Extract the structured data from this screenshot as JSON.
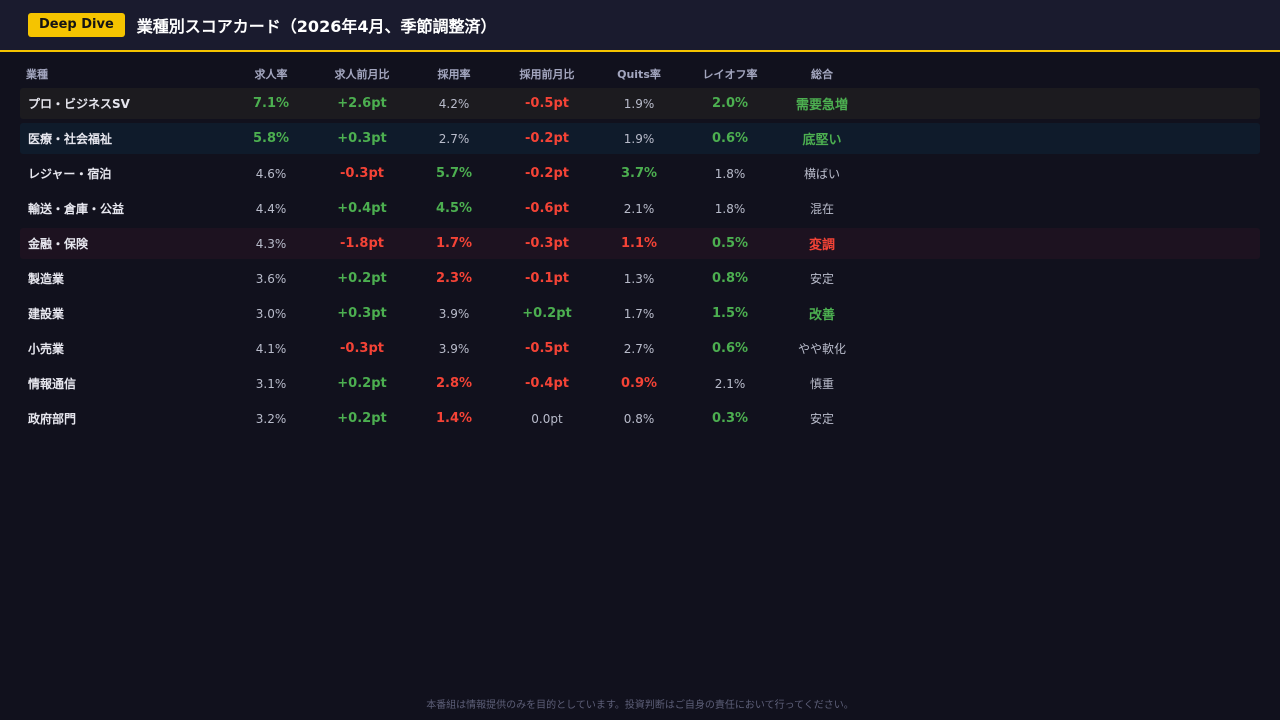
{
  "header": {
    "badge": "Deep Dive",
    "title": "業種別スコアカード（2026年4月、季節調整済）"
  },
  "table": {
    "columns": [
      "業種",
      "求人率",
      "求人前月比",
      "採用率",
      "採用前月比",
      "Quits率",
      "レイオフ率",
      "総合"
    ],
    "rows": [
      {
        "highlight": "amber",
        "cells": [
          {
            "text": "プロ・ビジネスSV",
            "tone": "name"
          },
          {
            "text": "7.1%",
            "tone": "green"
          },
          {
            "text": "+2.6pt",
            "tone": "green"
          },
          {
            "text": "4.2%",
            "tone": "plain"
          },
          {
            "text": "-0.5pt",
            "tone": "red"
          },
          {
            "text": "1.9%",
            "tone": "plain"
          },
          {
            "text": "2.0%",
            "tone": "green"
          },
          {
            "text": "需要急増",
            "tone": "green"
          }
        ]
      },
      {
        "highlight": "blue",
        "cells": [
          {
            "text": "医療・社会福祉",
            "tone": "name"
          },
          {
            "text": "5.8%",
            "tone": "green"
          },
          {
            "text": "+0.3pt",
            "tone": "green"
          },
          {
            "text": "2.7%",
            "tone": "plain"
          },
          {
            "text": "-0.2pt",
            "tone": "red"
          },
          {
            "text": "1.9%",
            "tone": "plain"
          },
          {
            "text": "0.6%",
            "tone": "green"
          },
          {
            "text": "底堅い",
            "tone": "green"
          }
        ]
      },
      {
        "highlight": "none",
        "cells": [
          {
            "text": "レジャー・宿泊",
            "tone": "name"
          },
          {
            "text": "4.6%",
            "tone": "plain"
          },
          {
            "text": "-0.3pt",
            "tone": "red"
          },
          {
            "text": "5.7%",
            "tone": "green"
          },
          {
            "text": "-0.2pt",
            "tone": "red"
          },
          {
            "text": "3.7%",
            "tone": "green"
          },
          {
            "text": "1.8%",
            "tone": "plain"
          },
          {
            "text": "横ばい",
            "tone": "plain"
          }
        ]
      },
      {
        "highlight": "none",
        "cells": [
          {
            "text": "輸送・倉庫・公益",
            "tone": "name"
          },
          {
            "text": "4.4%",
            "tone": "plain"
          },
          {
            "text": "+0.4pt",
            "tone": "green"
          },
          {
            "text": "4.5%",
            "tone": "green"
          },
          {
            "text": "-0.6pt",
            "tone": "red"
          },
          {
            "text": "2.1%",
            "tone": "plain"
          },
          {
            "text": "1.8%",
            "tone": "plain"
          },
          {
            "text": "混在",
            "tone": "plain"
          }
        ]
      },
      {
        "highlight": "red",
        "cells": [
          {
            "text": "金融・保険",
            "tone": "name"
          },
          {
            "text": "4.3%",
            "tone": "plain"
          },
          {
            "text": "-1.8pt",
            "tone": "red"
          },
          {
            "text": "1.7%",
            "tone": "red"
          },
          {
            "text": "-0.3pt",
            "tone": "red"
          },
          {
            "text": "1.1%",
            "tone": "red"
          },
          {
            "text": "0.5%",
            "tone": "green"
          },
          {
            "text": "変調",
            "tone": "red"
          }
        ]
      },
      {
        "highlight": "none",
        "cells": [
          {
            "text": "製造業",
            "tone": "name"
          },
          {
            "text": "3.6%",
            "tone": "plain"
          },
          {
            "text": "+0.2pt",
            "tone": "green"
          },
          {
            "text": "2.3%",
            "tone": "red"
          },
          {
            "text": "-0.1pt",
            "tone": "red"
          },
          {
            "text": "1.3%",
            "tone": "plain"
          },
          {
            "text": "0.8%",
            "tone": "green"
          },
          {
            "text": "安定",
            "tone": "plain"
          }
        ]
      },
      {
        "highlight": "none",
        "cells": [
          {
            "text": "建設業",
            "tone": "name"
          },
          {
            "text": "3.0%",
            "tone": "plain"
          },
          {
            "text": "+0.3pt",
            "tone": "green"
          },
          {
            "text": "3.9%",
            "tone": "plain"
          },
          {
            "text": "+0.2pt",
            "tone": "green"
          },
          {
            "text": "1.7%",
            "tone": "plain"
          },
          {
            "text": "1.5%",
            "tone": "green"
          },
          {
            "text": "改善",
            "tone": "green"
          }
        ]
      },
      {
        "highlight": "none",
        "cells": [
          {
            "text": "小売業",
            "tone": "name"
          },
          {
            "text": "4.1%",
            "tone": "plain"
          },
          {
            "text": "-0.3pt",
            "tone": "red"
          },
          {
            "text": "3.9%",
            "tone": "plain"
          },
          {
            "text": "-0.5pt",
            "tone": "red"
          },
          {
            "text": "2.7%",
            "tone": "plain"
          },
          {
            "text": "0.6%",
            "tone": "green"
          },
          {
            "text": "やや軟化",
            "tone": "plain"
          }
        ]
      },
      {
        "highlight": "none",
        "cells": [
          {
            "text": "情報通信",
            "tone": "name"
          },
          {
            "text": "3.1%",
            "tone": "plain"
          },
          {
            "text": "+0.2pt",
            "tone": "green"
          },
          {
            "text": "2.8%",
            "tone": "red"
          },
          {
            "text": "-0.4pt",
            "tone": "red"
          },
          {
            "text": "0.9%",
            "tone": "red"
          },
          {
            "text": "2.1%",
            "tone": "plain"
          },
          {
            "text": "慎重",
            "tone": "plain"
          }
        ]
      },
      {
        "highlight": "none",
        "cells": [
          {
            "text": "政府部門",
            "tone": "name"
          },
          {
            "text": "3.2%",
            "tone": "plain"
          },
          {
            "text": "+0.2pt",
            "tone": "green"
          },
          {
            "text": "1.4%",
            "tone": "red"
          },
          {
            "text": "0.0pt",
            "tone": "plain"
          },
          {
            "text": "0.8%",
            "tone": "plain"
          },
          {
            "text": "0.3%",
            "tone": "green"
          },
          {
            "text": "安定",
            "tone": "plain"
          }
        ]
      }
    ]
  },
  "colors": {
    "accent": "#f5c400",
    "positive": "#4caf50",
    "negative": "#f44336",
    "background": "#11111d"
  },
  "footer": {
    "disclaimer": "本番組は情報提供のみを目的としています。投資判断はご自身の責任において行ってください。"
  }
}
